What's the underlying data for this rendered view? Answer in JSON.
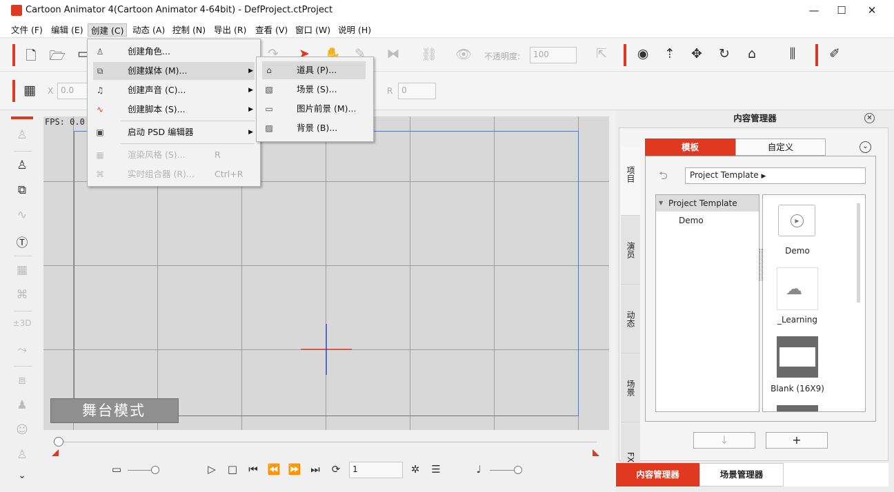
{
  "window": {
    "title": "Cartoon Animator 4(Cartoon Animator 4-64bit) - DefProject.ctProject"
  },
  "menubar": [
    "文件 (F)",
    "编辑 (E)",
    "创建 (C)",
    "动态 (A)",
    "控制 (N)",
    "导出 (R)",
    "查看 (V)",
    "窗口 (W)",
    "说明 (H)"
  ],
  "toolbar": {
    "opacity_label": "不透明度:",
    "opacity_value": "100"
  },
  "transform": {
    "x_label": "X",
    "x_value": "0.0",
    "r_label": "R",
    "r_value": "0"
  },
  "create_menu": {
    "items": [
      {
        "label": "创建角色...",
        "icon": "character-icon",
        "submenu": false
      },
      {
        "label": "创建媒体 (M)...",
        "icon": "media-icon",
        "submenu": true,
        "highlighted": true
      },
      {
        "label": "创建声音 (C)...",
        "icon": "music-note-icon",
        "submenu": true
      },
      {
        "label": "创建脚本 (S)...",
        "icon": "script-wave-icon",
        "submenu": true
      },
      {
        "label": "启动 PSD 编辑器",
        "icon": "psd-editor-icon",
        "submenu": true
      },
      {
        "label": "渲染风格 (S)...",
        "shortcut": "R",
        "disabled": true
      },
      {
        "label": "实时组合器 (R)...",
        "shortcut": "Ctrl+R",
        "disabled": true
      }
    ]
  },
  "media_submenu": {
    "items": [
      {
        "label": "道具 (P)...",
        "icon": "prop-icon",
        "highlighted": true
      },
      {
        "label": "场景 (S)...",
        "icon": "scene-icon"
      },
      {
        "label": "图片前景 (M)...",
        "icon": "foreground-icon"
      },
      {
        "label": "背景 (B)...",
        "icon": "background-icon"
      }
    ]
  },
  "stage": {
    "fps": "FPS: 0.0",
    "mode_label": "舞台模式"
  },
  "timeline": {
    "frame": "1"
  },
  "content_manager": {
    "title": "内容管理器",
    "side_tabs": [
      "项目",
      "演员",
      "动态",
      "场景",
      "FX"
    ],
    "tabs": [
      "模板",
      "自定义"
    ],
    "path": "Project Template",
    "tree_root": "Project Template",
    "tree_child": "Demo",
    "thumbnails": [
      "Demo",
      "_Learning",
      "Blank (16X9)"
    ],
    "add_label": "+",
    "down_label": "↓"
  },
  "bottom_tabs": [
    "内容管理器",
    "场景管理器"
  ],
  "colors": {
    "accent": "#e0391f",
    "stage": "#d8d8d8",
    "frame_border": "#5a78b3"
  }
}
